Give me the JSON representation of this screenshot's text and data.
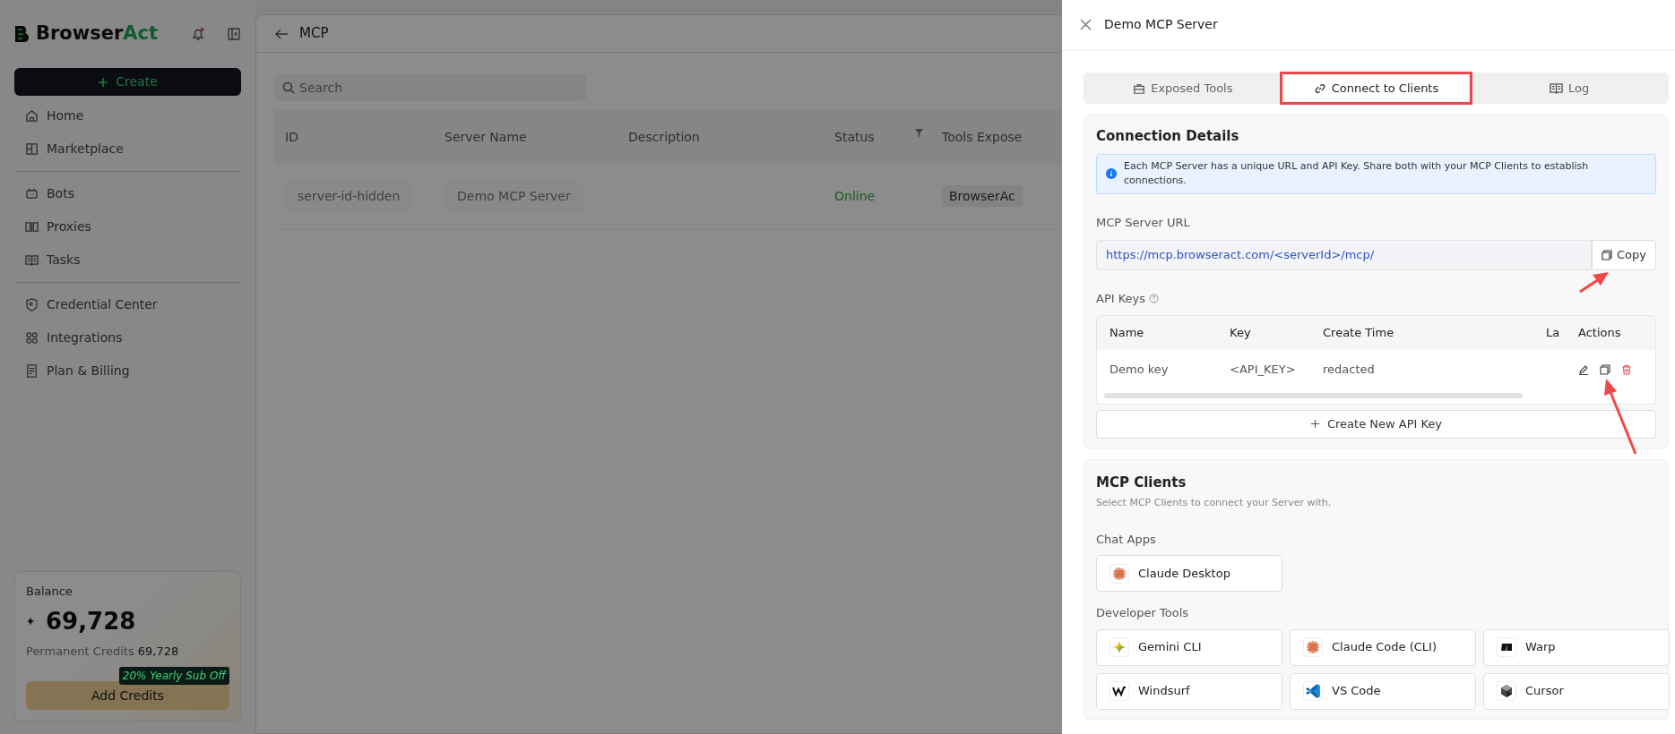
{
  "sidebar": {
    "brand": {
      "first": "Browser",
      "second": "Act"
    },
    "notifications_unread": true,
    "create_button": {
      "label": "Create"
    },
    "nav_groups": [
      [
        {
          "label": "Home"
        },
        {
          "label": "Marketplace"
        }
      ],
      [
        {
          "label": "Bots"
        },
        {
          "label": "Proxies"
        },
        {
          "label": "Tasks"
        }
      ],
      [
        {
          "label": "Credential Center"
        },
        {
          "label": "Integrations"
        },
        {
          "label": "Plan & Billing"
        }
      ]
    ],
    "balance": {
      "label": "Balance",
      "amount": "69,728",
      "permanent_label": "Permanent Credits",
      "permanent_value": "69,728",
      "promo": "20% Yearly Sub Off",
      "button": "Add Credits"
    }
  },
  "page": {
    "title": "MCP",
    "search": {
      "placeholder": "Search"
    },
    "table": {
      "columns": [
        "ID",
        "Server Name",
        "Description",
        "Status",
        "Tools Expose"
      ],
      "rows": [
        {
          "id": "server-id-hidden",
          "server_name": "Demo MCP Server",
          "status": "Online",
          "tools_exposed": "BrowserAc"
        }
      ]
    }
  },
  "drawer": {
    "title": "Demo MCP Server",
    "tabs": [
      {
        "label": "Exposed Tools",
        "selected": false,
        "highlighted": false
      },
      {
        "label": "Connect to Clients",
        "selected": true,
        "highlighted": true
      },
      {
        "label": "Log",
        "selected": false,
        "highlighted": false
      }
    ],
    "connection_details": {
      "title": "Connection Details",
      "info": "Each MCP Server has a unique URL and API Key. Share both with your MCP Clients to establish connections.",
      "url_label": "MCP Server URL",
      "url": "https://mcp.browseract.com/<serverId>/mcp/",
      "copy_label": "Copy",
      "api_keys_label": "API Keys",
      "api_key_columns": [
        "Name",
        "Key",
        "Create Time",
        "La",
        "Actions"
      ],
      "api_keys": [
        {
          "name": "Demo key",
          "key": "<API_KEY>",
          "create_time": "redacted"
        }
      ],
      "create_key_label": "Create New API Key"
    },
    "clients": {
      "title": "MCP Clients",
      "subtitle": "Select MCP Clients to connect your Server with.",
      "groups": [
        {
          "label": "Chat Apps",
          "items": [
            {
              "label": "Claude Desktop"
            }
          ]
        },
        {
          "label": "Developer Tools",
          "items": [
            {
              "label": "Gemini CLI"
            },
            {
              "label": "Claude Code (CLI)"
            },
            {
              "label": "Warp"
            },
            {
              "label": "Windsurf"
            },
            {
              "label": "VS Code"
            },
            {
              "label": "Cursor"
            }
          ]
        }
      ]
    }
  }
}
